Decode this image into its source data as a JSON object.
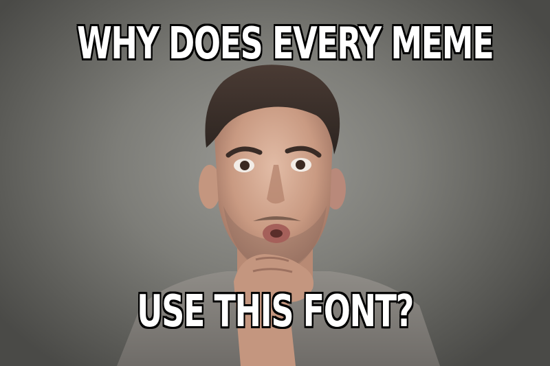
{
  "meme": {
    "top_text": "WHY DOES EVERY MEME",
    "bottom_text": "USE THIS FONT?"
  }
}
